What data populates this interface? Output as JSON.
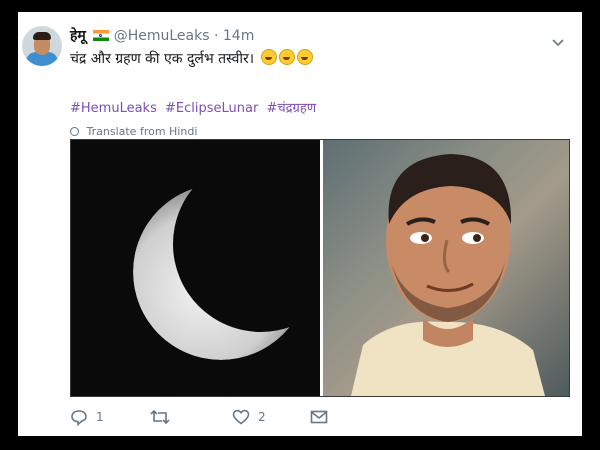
{
  "tweet": {
    "author_name": "हेमू",
    "handle": "@HemuLeaks",
    "separator": "·",
    "time": "14m",
    "text": "चंद्र और ग्रहण की एक दुर्लभ तस्वीर।",
    "emojis": [
      "rolling-on-floor-laughing",
      "rolling-on-floor-laughing",
      "rolling-on-floor-laughing"
    ],
    "hashtags": [
      "#HemuLeaks",
      "#EclipseLunar",
      "#चंद्रग्रहण"
    ],
    "translate_label": "Translate from Hindi",
    "hashtag_color": "#7d4fb3",
    "media": {
      "left": "crescent-moon-photo",
      "right": "smiling-man-photo"
    },
    "actions": {
      "reply_count": "1",
      "retweet_count": "",
      "like_count": "2"
    }
  }
}
